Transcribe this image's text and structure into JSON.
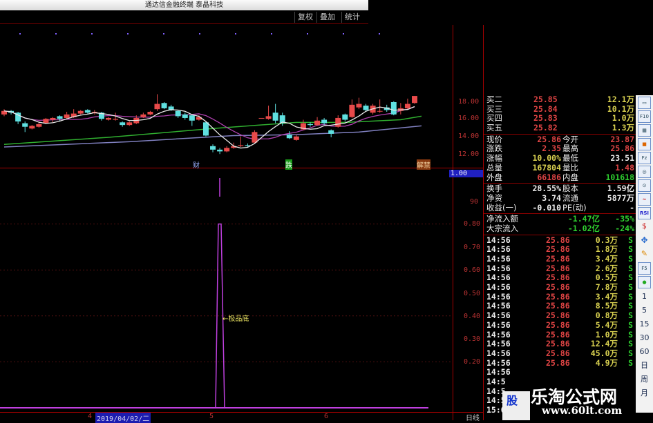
{
  "window": {
    "title": "通达信金融终端 泰晶科技"
  },
  "toolbar": {
    "buttons": [
      "复权",
      "叠加",
      "统计"
    ]
  },
  "price_axis": {
    "ticks": [
      "18.00",
      "16.00",
      "14.00",
      "12.00"
    ]
  },
  "indicator_axis": {
    "current": "1.00",
    "ticks": [
      "90",
      "0.80",
      "0.70",
      "0.60",
      "0.50",
      "0.40",
      "0.30",
      "0.20"
    ]
  },
  "markers": {
    "cai": "财",
    "die": "跌",
    "jiejin": "解禁"
  },
  "annotation": "←极品底",
  "date_axis": {
    "labels": [
      "4",
      "5",
      "6"
    ],
    "cursor_date": "2019/04/02/二",
    "period": "日线"
  },
  "colors": {
    "up": "#e84a4a",
    "down": "#5fe0e0",
    "ma5": "#e8e8e8",
    "ma10": "#b040b0",
    "ma30": "#30b030",
    "ma60": "#8080c0",
    "indicator": "#c040e0"
  },
  "candles": [
    [
      16.6,
      17.0,
      17.2,
      16.4
    ],
    [
      17.0,
      16.8,
      17.1,
      16.6
    ],
    [
      16.8,
      15.8,
      16.9,
      15.5
    ],
    [
      15.6,
      15.2,
      15.8,
      14.6
    ],
    [
      15.0,
      15.3,
      15.4,
      14.9
    ],
    [
      15.2,
      15.5,
      15.7,
      15.1
    ],
    [
      15.6,
      16.1,
      16.2,
      15.5
    ],
    [
      16.0,
      16.2,
      16.3,
      15.7
    ],
    [
      16.4,
      16.1,
      16.5,
      15.8
    ],
    [
      16.2,
      16.6,
      16.9,
      16.1
    ],
    [
      16.3,
      16.7,
      17.2,
      16.2
    ],
    [
      16.7,
      17.0,
      17.1,
      16.6
    ],
    [
      17.1,
      16.8,
      17.2,
      16.7
    ],
    [
      16.8,
      16.9,
      17.1,
      16.6
    ],
    [
      16.8,
      16.1,
      16.9,
      15.9
    ],
    [
      16.0,
      16.2,
      16.3,
      15.9
    ],
    [
      16.0,
      16.1,
      16.8,
      15.9
    ],
    [
      15.7,
      15.4,
      15.8,
      15.2
    ],
    [
      15.4,
      15.7,
      15.8,
      15.3
    ],
    [
      15.6,
      16.2,
      16.5,
      15.5
    ],
    [
      16.3,
      16.6,
      16.8,
      16.2
    ],
    [
      16.6,
      16.9,
      17.0,
      16.5
    ],
    [
      17.2,
      17.8,
      18.9,
      17.0
    ],
    [
      17.9,
      17.3,
      18.0,
      17.2
    ],
    [
      17.5,
      17.1,
      17.7,
      17.0
    ],
    [
      17.0,
      16.4,
      17.1,
      16.2
    ],
    [
      16.6,
      16.2,
      16.8,
      16.0
    ],
    [
      16.5,
      15.9,
      16.6,
      15.3
    ],
    [
      16.0,
      16.3,
      16.5,
      15.9
    ],
    [
      15.7,
      14.2,
      15.8,
      14.1
    ],
    [
      13.0,
      12.6,
      13.2,
      12.3
    ],
    [
      12.6,
      12.4,
      12.8,
      12.1
    ],
    [
      12.4,
      12.8,
      13.0,
      12.3
    ],
    [
      12.8,
      13.0,
      13.4,
      12.7
    ],
    [
      13.0,
      13.1,
      14.1,
      12.9
    ],
    [
      13.1,
      13.0,
      13.3,
      12.9
    ],
    [
      13.4,
      14.6,
      14.8,
      13.3
    ],
    [
      16.2,
      16.2,
      16.2,
      16.2
    ],
    [
      16.1,
      16.4,
      17.6,
      16.0
    ],
    [
      16.8,
      15.9,
      17.8,
      15.6
    ],
    [
      16.5,
      15.6,
      16.8,
      15.3
    ],
    [
      14.3,
      13.9,
      14.7,
      13.8
    ],
    [
      13.7,
      14.1,
      14.3,
      13.6
    ],
    [
      14.9,
      15.6,
      16.0,
      14.8
    ],
    [
      15.5,
      15.4,
      15.7,
      15.2
    ],
    [
      15.4,
      15.9,
      16.3,
      15.3
    ],
    [
      16.0,
      15.6,
      16.2,
      15.4
    ],
    [
      14.8,
      14.4,
      14.9,
      14.0
    ],
    [
      15.2,
      16.2,
      16.5,
      15.1
    ],
    [
      16.6,
      16.0,
      16.7,
      15.8
    ],
    [
      16.3,
      17.7,
      18.3,
      16.2
    ],
    [
      17.4,
      17.8,
      18.5,
      17.2
    ],
    [
      17.6,
      17.1,
      17.8,
      16.9
    ],
    [
      16.8,
      17.6,
      17.8,
      16.6
    ],
    [
      17.0,
      17.0,
      18.3,
      16.8
    ],
    [
      17.4,
      17.1,
      17.7,
      16.9
    ],
    [
      18.0,
      16.6,
      18.1,
      16.5
    ],
    [
      17.0,
      17.3,
      17.9,
      16.6
    ],
    [
      17.3,
      17.8,
      18.4,
      17.2
    ],
    [
      17.9,
      18.7,
      18.7,
      17.8
    ]
  ],
  "ma30": [
    [
      13.2,
      0
    ],
    [
      14.0,
      0.25
    ],
    [
      15.0,
      0.5
    ],
    [
      15.7,
      0.7
    ],
    [
      15.7,
      0.82
    ],
    [
      16.0,
      0.95
    ],
    [
      16.4,
      1
    ]
  ],
  "ma60": [
    [
      12.9,
      0
    ],
    [
      13.5,
      0.3
    ],
    [
      14.2,
      0.55
    ],
    [
      14.3,
      0.7
    ],
    [
      14.6,
      0.85
    ],
    [
      15.3,
      1
    ]
  ],
  "indicator_series": {
    "baseline": 0,
    "spike_value": 1.0,
    "spike_index": "2019/04/02"
  },
  "quote": {
    "bids": [
      [
        "买二",
        "25.85",
        "12.1万"
      ],
      [
        "买三",
        "25.84",
        "10.1万"
      ],
      [
        "买四",
        "25.83",
        "1.0万"
      ],
      [
        "买五",
        "25.82",
        "1.3万"
      ]
    ],
    "stats": [
      [
        "现价",
        "25.86",
        "今开",
        "23.87"
      ],
      [
        "涨跌",
        "2.35",
        "最高",
        "25.86"
      ],
      [
        "涨幅",
        "10.00%",
        "最低",
        "23.51"
      ],
      [
        "总量",
        "167804",
        "量比",
        "1.48"
      ],
      [
        "外盘",
        "66186",
        "内盘",
        "101618"
      ]
    ],
    "stats2": [
      [
        "换手",
        "28.55%",
        "股本",
        "1.59亿"
      ],
      [
        "净资",
        "3.74",
        "流通",
        "5877万"
      ],
      [
        "收益(一)",
        "-0.010",
        "PE(动)",
        "-"
      ]
    ],
    "flows": [
      [
        "净流入额",
        "-1.47亿",
        "-35%"
      ],
      [
        "大宗流入",
        "-1.02亿",
        "-24%"
      ]
    ]
  },
  "ticks": [
    [
      "14:56",
      "25.86",
      "0.3万",
      "S"
    ],
    [
      "14:56",
      "25.86",
      "1.8万",
      "S"
    ],
    [
      "14:56",
      "25.86",
      "3.4万",
      "S"
    ],
    [
      "14:56",
      "25.86",
      "2.6万",
      "S"
    ],
    [
      "14:56",
      "25.86",
      "0.5万",
      "S"
    ],
    [
      "14:56",
      "25.86",
      "7.8万",
      "S"
    ],
    [
      "14:56",
      "25.86",
      "3.4万",
      "S"
    ],
    [
      "14:56",
      "25.86",
      "8.5万",
      "S"
    ],
    [
      "14:56",
      "25.86",
      "0.8万",
      "S"
    ],
    [
      "14:56",
      "25.86",
      "5.4万",
      "S"
    ],
    [
      "14:56",
      "25.86",
      "1.0万",
      "S"
    ],
    [
      "14:56",
      "25.86",
      "12.4万",
      "S"
    ],
    [
      "14:56",
      "25.86",
      "45.0万",
      "S"
    ],
    [
      "14:56",
      "25.86",
      "4.9万",
      "S"
    ],
    [
      "14:56",
      "",
      "",
      ""
    ],
    [
      "14:5",
      "",
      "",
      ""
    ],
    [
      "14:5",
      "",
      "",
      ""
    ],
    [
      "14:5",
      "",
      "",
      ""
    ],
    [
      "15:0",
      "",
      "",
      ""
    ]
  ],
  "sidebar_icons": [
    "F10",
    "F5"
  ],
  "period_buttons": [
    "1",
    "5",
    "15",
    "30",
    "60",
    "日",
    "周",
    "月"
  ],
  "watermark": {
    "site": "乐淘公式网",
    "url": "www.60lt.com",
    "logo": "股"
  }
}
